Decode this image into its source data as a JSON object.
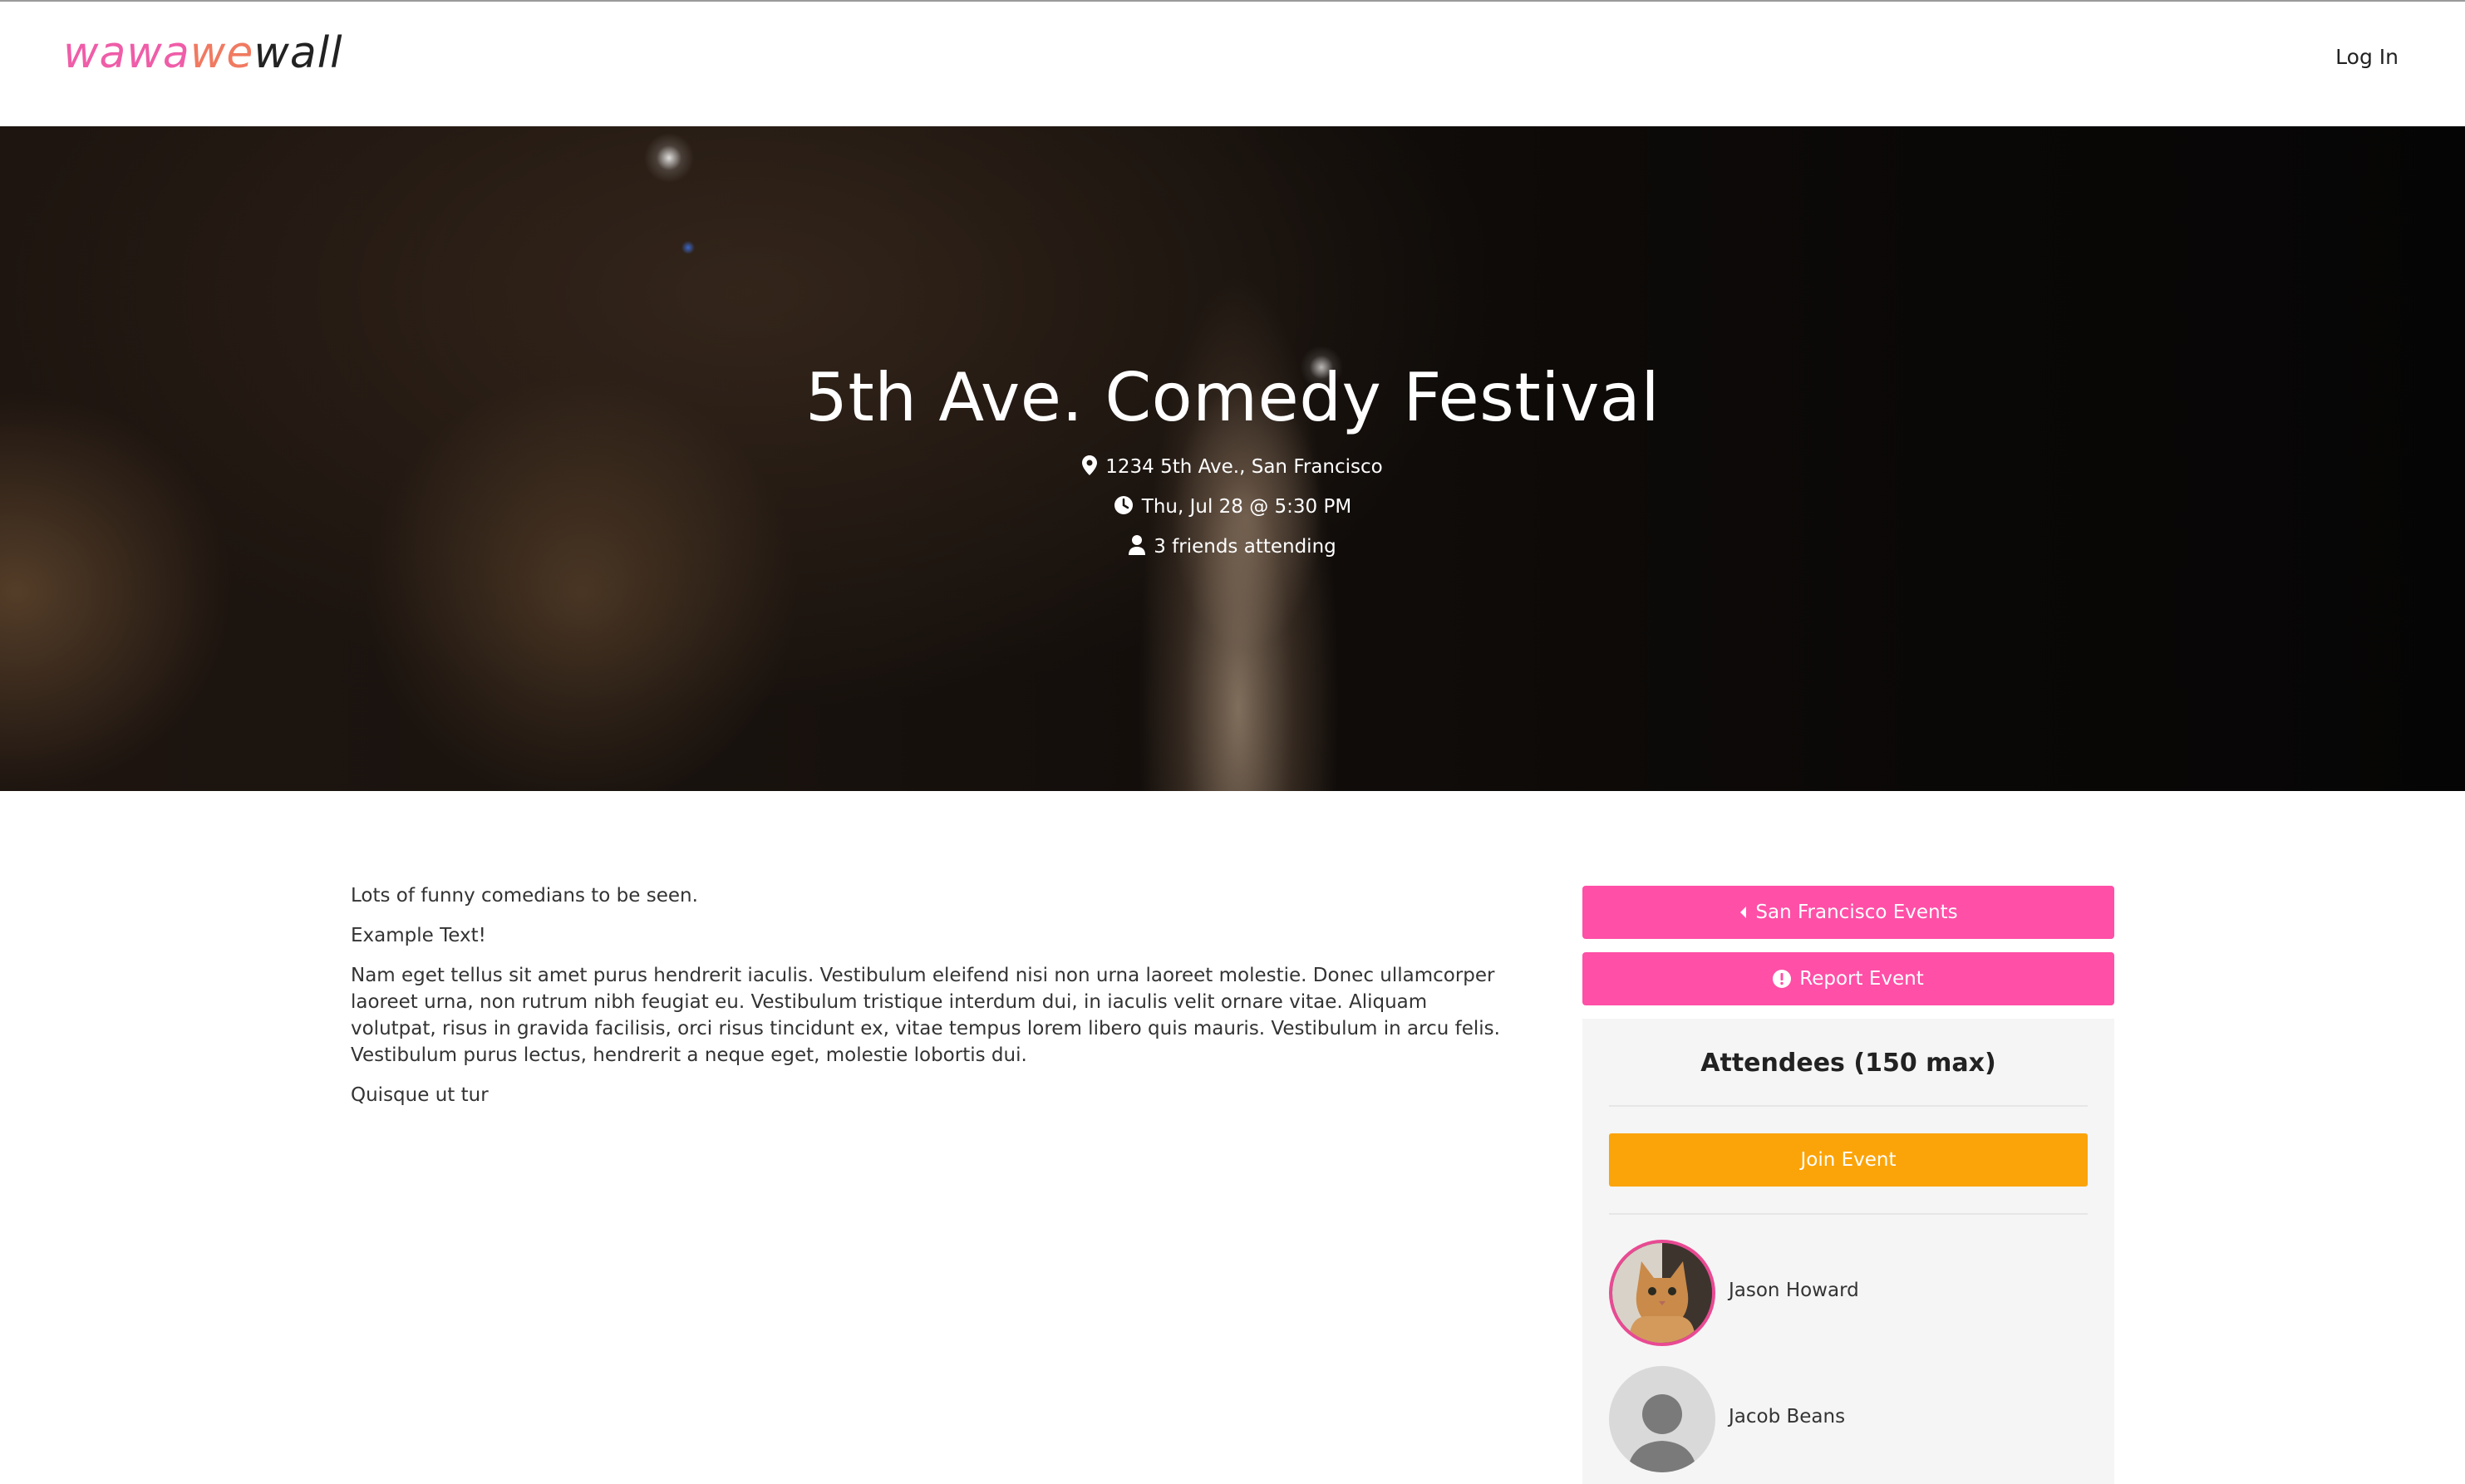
{
  "navbar": {
    "logo_part1": "wawa",
    "logo_part2": "we",
    "logo_part3": "wall",
    "login_label": "Log In"
  },
  "hero": {
    "title": "5th Ave. Comedy Festival",
    "location": "1234 5th Ave., San Francisco",
    "datetime": "Thu, Jul 28 @ 5:30 PM",
    "friends": "3 friends attending",
    "location_icon": "map-pin-icon",
    "time_icon": "clock-icon",
    "friends_icon": "user-icon"
  },
  "description": {
    "p1": "Lots of funny comedians to be seen.",
    "p2": "Example Text!",
    "p3": "Nam eget tellus sit amet purus hendrerit iaculis. Vestibulum eleifend nisi non urna laoreet molestie. Donec ullamcorper laoreet urna, non rutrum nibh feugiat eu. Vestibulum tristique interdum dui, in iaculis velit ornare vitae. Aliquam volutpat, risus in gravida facilisis, orci risus tincidunt ex, vitae tempus lorem libero quis mauris. Vestibulum in arcu felis. Vestibulum purus lectus, hendrerit a neque eget, molestie lobortis dui.",
    "p4": "Quisque ut tur"
  },
  "sidebar": {
    "back_label": "San Francisco Events",
    "report_label": "Report Event",
    "attendees_title": "Attendees (150 max)",
    "join_label": "Join Event",
    "attendees": [
      {
        "name": "Jason Howard"
      },
      {
        "name": "Jacob Beans"
      }
    ]
  },
  "colors": {
    "accent_pink": "#ff4fa7",
    "join_orange": "#fba40a",
    "logo_pink": "#ef5da8",
    "logo_orange": "#f07a61"
  }
}
